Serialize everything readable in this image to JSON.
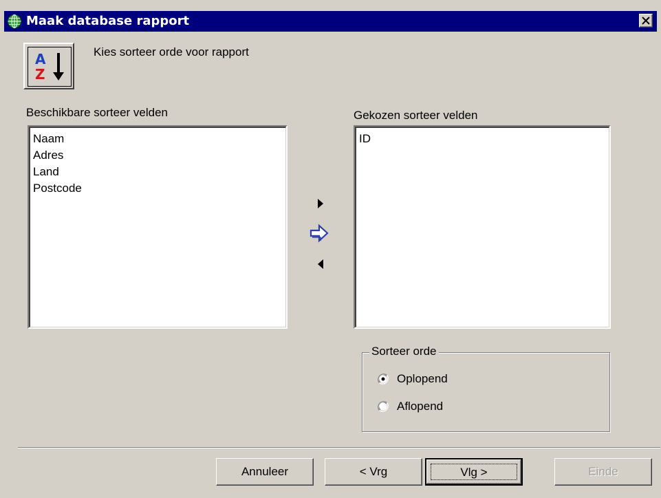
{
  "window": {
    "title": "Maak database rapport",
    "icon": "globe-icon",
    "close_icon": "close-icon"
  },
  "header": {
    "icon": "sort-az-icon",
    "subtitle": "Kies sorteer orde voor rapport"
  },
  "available": {
    "label": "Beschikbare sorteer velden",
    "items": [
      "Naam",
      "Adres",
      "Land",
      "Postcode"
    ]
  },
  "selected": {
    "label": "Gekozen sorteer velden",
    "items": [
      "ID"
    ]
  },
  "transfer": {
    "add_icon": "triangle-right-icon",
    "move_icon": "arrow-right-icon",
    "remove_icon": "triangle-left-icon"
  },
  "sort_order": {
    "legend": "Sorteer orde",
    "options": [
      {
        "label": "Oplopend",
        "checked": true
      },
      {
        "label": "Aflopend",
        "checked": false
      }
    ]
  },
  "buttons": {
    "cancel": "Annuleer",
    "back": "< Vrg",
    "next": "Vlg >",
    "finish": "Einde"
  },
  "colors": {
    "titlebar": "#00007f",
    "face": "#d4d0c8",
    "arrow_accent": "#2a3fa8"
  }
}
